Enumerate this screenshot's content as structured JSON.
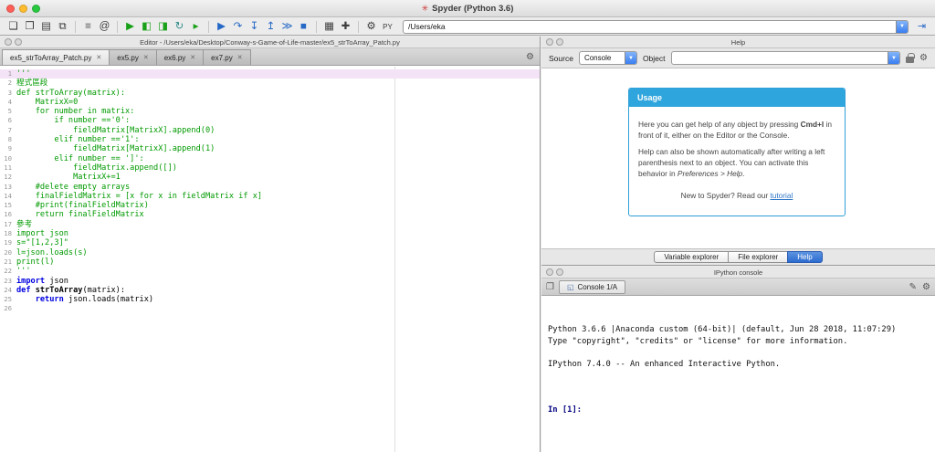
{
  "window": {
    "title": "Spyder (Python 3.6)",
    "traffic_colors": [
      "#ff5f57",
      "#febc2e",
      "#28c840"
    ]
  },
  "icons": {
    "logo": "✳",
    "gear": "⚙",
    "close": "✕",
    "pencil": "✎",
    "new_console": "❐",
    "console_tab": "◱"
  },
  "toolbar": {
    "path_value": "/Users/eka",
    "parent_glyph": "⇥",
    "items": [
      {
        "name": "new-file",
        "g": "❏",
        "c": "#3e3e3e"
      },
      {
        "name": "open-file",
        "g": "❐",
        "c": "#3e3e3e"
      },
      {
        "name": "save-file",
        "g": "▤",
        "c": "#3e3e3e"
      },
      {
        "name": "save-all",
        "g": "⧉",
        "c": "#3e3e3e"
      },
      {
        "sep": true
      },
      {
        "name": "file-switcher",
        "g": "≡",
        "c": "#3e3e3e"
      },
      {
        "name": "find-symbols",
        "g": "@",
        "c": "#3e3e3e"
      },
      {
        "sep": true
      },
      {
        "name": "run-file",
        "g": "▶",
        "c": "#18a018"
      },
      {
        "name": "run-cell",
        "g": "◧",
        "c": "#18a018"
      },
      {
        "name": "run-cell-advance",
        "g": "◨",
        "c": "#18a018"
      },
      {
        "name": "rerun-cell",
        "g": "↻",
        "c": "#2e8b8b"
      },
      {
        "name": "run-selection",
        "g": "▸",
        "c": "#18a018"
      },
      {
        "sep": true
      },
      {
        "name": "debug-file",
        "g": "▶",
        "c": "#2668c5"
      },
      {
        "name": "step-over",
        "g": "↷",
        "c": "#2668c5"
      },
      {
        "name": "step-into",
        "g": "↧",
        "c": "#2668c5"
      },
      {
        "name": "step-return",
        "g": "↥",
        "c": "#2668c5"
      },
      {
        "name": "continue-execution",
        "g": "≫",
        "c": "#2668c5"
      },
      {
        "name": "stop-debug",
        "g": "■",
        "c": "#2668c5"
      },
      {
        "sep": true
      },
      {
        "name": "maximize-pane",
        "g": "▦",
        "c": "#3e3e3e"
      },
      {
        "name": "fullscreen",
        "g": "✚",
        "c": "#3e3e3e"
      },
      {
        "sep": true
      },
      {
        "name": "preferences",
        "g": "⚙",
        "c": "#3e3e3e"
      },
      {
        "name": "python-path-manager",
        "g": "PY",
        "c": "#3e3e3e"
      }
    ]
  },
  "editor": {
    "title": "Editor - /Users/eka/Desktop/Conway-s-Game-of-Life-master/ex5_strToArray_Patch.py",
    "tabs": [
      {
        "label": "ex5_strToArray_Patch.py",
        "active": true
      },
      {
        "label": "ex5.py",
        "active": false
      },
      {
        "label": "ex6.py",
        "active": false
      },
      {
        "label": "ex7.py",
        "active": false
      }
    ],
    "current_line": 1,
    "lines": [
      {
        "n": 1,
        "seg": [
          {
            "t": "'''",
            "c": "str"
          }
        ]
      },
      {
        "n": 2,
        "seg": [
          {
            "t": "程式區段",
            "c": "str"
          }
        ]
      },
      {
        "n": 3,
        "seg": [
          {
            "t": "def strToArray(matrix):",
            "c": "str"
          }
        ]
      },
      {
        "n": 4,
        "seg": [
          {
            "t": "    MatrixX=0",
            "c": "str"
          }
        ]
      },
      {
        "n": 5,
        "seg": [
          {
            "t": "    for number in matrix:",
            "c": "str"
          }
        ]
      },
      {
        "n": 6,
        "seg": [
          {
            "t": "        if number =='0':",
            "c": "str"
          }
        ]
      },
      {
        "n": 7,
        "seg": [
          {
            "t": "            fieldMatrix[MatrixX].append(0)",
            "c": "str"
          }
        ]
      },
      {
        "n": 8,
        "seg": [
          {
            "t": "        elif number =='1':",
            "c": "str"
          }
        ]
      },
      {
        "n": 9,
        "seg": [
          {
            "t": "            fieldMatrix[MatrixX].append(1)",
            "c": "str"
          }
        ]
      },
      {
        "n": 10,
        "seg": [
          {
            "t": "        elif number == ']':",
            "c": "str"
          }
        ]
      },
      {
        "n": 11,
        "seg": [
          {
            "t": "            fieldMatrix.append([])",
            "c": "str"
          }
        ]
      },
      {
        "n": 12,
        "seg": [
          {
            "t": "            MatrixX+=1",
            "c": "str"
          }
        ]
      },
      {
        "n": 13,
        "seg": [
          {
            "t": "    #delete empty arrays",
            "c": "str"
          }
        ]
      },
      {
        "n": 14,
        "seg": [
          {
            "t": "    finalFieldMatrix = [x for x in fieldMatrix if x]",
            "c": "str"
          }
        ]
      },
      {
        "n": 15,
        "seg": [
          {
            "t": "    #print(finalFieldMatrix)",
            "c": "str"
          }
        ]
      },
      {
        "n": 16,
        "seg": [
          {
            "t": "    return finalFieldMatrix",
            "c": "str"
          }
        ]
      },
      {
        "n": 17,
        "seg": [
          {
            "t": "參考",
            "c": "str"
          }
        ]
      },
      {
        "n": 18,
        "seg": [
          {
            "t": "import json",
            "c": "str"
          }
        ]
      },
      {
        "n": 19,
        "seg": [
          {
            "t": "s=\"[1,2,3]\"",
            "c": "str"
          }
        ]
      },
      {
        "n": 20,
        "seg": [
          {
            "t": "l=json.loads(s)",
            "c": "str"
          }
        ]
      },
      {
        "n": 21,
        "seg": [
          {
            "t": "print(l)",
            "c": "str"
          }
        ]
      },
      {
        "n": 22,
        "seg": [
          {
            "t": "'''",
            "c": "str"
          }
        ]
      },
      {
        "n": 23,
        "seg": [
          {
            "t": "import",
            "c": "kw"
          },
          {
            "t": " json",
            "c": "pl"
          }
        ]
      },
      {
        "n": 24,
        "seg": [
          {
            "t": "def",
            "c": "kw"
          },
          {
            "t": " ",
            "c": "pl"
          },
          {
            "t": "strToArray",
            "c": "fn"
          },
          {
            "t": "(matrix):",
            "c": "pl"
          }
        ]
      },
      {
        "n": 25,
        "seg": [
          {
            "t": "    ",
            "c": "pl"
          },
          {
            "t": "return",
            "c": "kw"
          },
          {
            "t": " json.loads(matrix)",
            "c": "pl"
          }
        ]
      },
      {
        "n": 26,
        "seg": []
      }
    ]
  },
  "help": {
    "title": "Help",
    "source_label": "Source",
    "source_value": "Console",
    "object_label": "Object",
    "object_value": "",
    "usage": {
      "title": "Usage",
      "p1": [
        {
          "t": "Here you can get help of any object by pressing "
        },
        {
          "t": "Cmd+I",
          "b": true
        },
        {
          "t": " in front of it, either on the Editor or the Console."
        }
      ],
      "p2": [
        {
          "t": "Help can also be shown automatically after writing a left parenthesis next to an object. You can activate this behavior in "
        },
        {
          "t": "Preferences > Help",
          "i": true
        },
        {
          "t": "."
        }
      ],
      "p3": [
        {
          "t": "New to Spyder? Read our "
        },
        {
          "t": "tutorial",
          "link": true
        }
      ]
    },
    "tabs": [
      {
        "label": "Variable explorer",
        "active": false
      },
      {
        "label": "File explorer",
        "active": false
      },
      {
        "label": "Help",
        "active": true
      }
    ]
  },
  "console": {
    "title": "IPython console",
    "tab": "Console 1/A",
    "lines": [
      "Python 3.6.6 |Anaconda custom (64-bit)| (default, Jun 28 2018, 11:07:29)",
      "Type \"copyright\", \"credits\" or \"license\" for more information.",
      "",
      "IPython 7.4.0 -- An enhanced Interactive Python.",
      ""
    ],
    "prompt": "In [1]:"
  }
}
